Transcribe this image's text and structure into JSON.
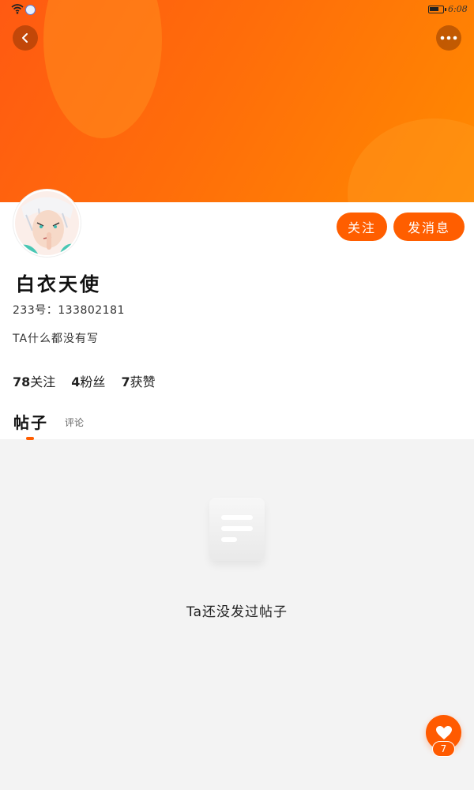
{
  "status_bar": {
    "time": "6:08"
  },
  "profile": {
    "name": "白衣天使",
    "uid_label": "233号：",
    "uid": "133802181",
    "bio": "TA什么都没有写",
    "follow_button": "关注",
    "message_button": "发消息"
  },
  "stats": [
    {
      "value": "78",
      "label": "关注"
    },
    {
      "value": "4",
      "label": "粉丝"
    },
    {
      "value": "7",
      "label": "获赞"
    }
  ],
  "tabs": {
    "posts": "帖子",
    "comments": "评论"
  },
  "empty_state": {
    "text": "Ta还没发过帖子"
  },
  "fab": {
    "count": "7"
  },
  "colors": {
    "accent": "#ff5e00",
    "banner_start": "#ff5a12",
    "banner_end": "#ff8a00"
  },
  "icons": [
    "wifi-icon",
    "app-badge-icon",
    "battery-icon",
    "back-arrow-icon",
    "more-dots-icon",
    "document-icon",
    "heart-icon"
  ]
}
